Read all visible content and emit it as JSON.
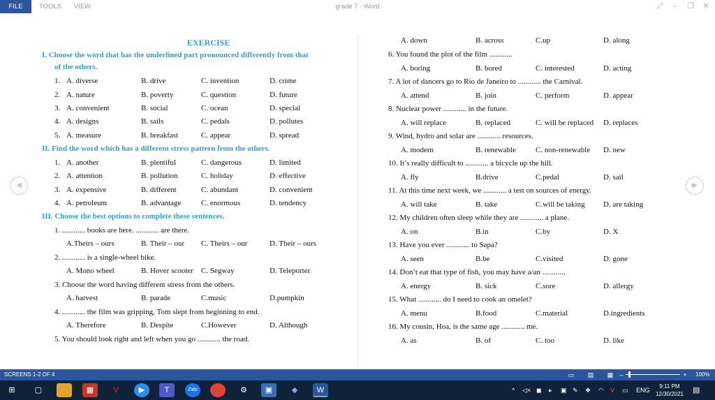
{
  "window": {
    "file_tab": "FILE",
    "tools_tab": "TOOLS",
    "view_tab": "VIEW",
    "title": "grade 7 - Word"
  },
  "left": {
    "title": "EXERCISE",
    "sec1_h1": "I.   Choose the word that has the underlined part pronounced differently from that",
    "sec1_h2": "of the others.",
    "s1": [
      {
        "n": "1.",
        "a": "A. diverse",
        "b": "B. drive",
        "c": "C. invention",
        "d": "D. crime"
      },
      {
        "n": "2.",
        "a": "A. nature",
        "b": "B. poverty",
        "c": "C. question",
        "d": "D. future"
      },
      {
        "n": "3.",
        "a": "A. convenient",
        "b": "B. social",
        "c": "C. ocean",
        "d": "D. special"
      },
      {
        "n": "4.",
        "a": "A. designs",
        "b": "B. sails",
        "c": "C. pedals",
        "d": "D. pollutes"
      },
      {
        "n": "5.",
        "a": "A. measure",
        "b": "B. breakfast",
        "c": "C. appear",
        "d": "D. spread"
      }
    ],
    "sec2_h": "II.  Find the word which has a different stress pattern from the others.",
    "s2": [
      {
        "n": "1.",
        "a": "A. another",
        "b": "B. plentiful",
        "c": "C. dangerous",
        "d": "D. limited"
      },
      {
        "n": "2.",
        "a": "A. attention",
        "b": "B. pollution",
        "c": "C. holiday",
        "d": "D. effective"
      },
      {
        "n": "3.",
        "a": "A. expensive",
        "b": "B. different",
        "c": "C. abundant",
        "d": "D. convenient"
      },
      {
        "n": "4.",
        "a": "A. petroleum",
        "b": "B. advantage",
        "c": "C. enormous",
        "d": "D. tendency"
      }
    ],
    "sec3_h": "III. Choose the best options to complete these sentences.",
    "q1": "1.   ............ books are here. ............ are there.",
    "q1o": {
      "a": "A.Theirs – ours",
      "b": "B. Their – our",
      "c": "C. Theirs – our",
      "d": "D. Their – ours"
    },
    "q2": "2.   ............ is a single-wheel bike.",
    "q2o": {
      "a": "A. Mono wheel",
      "b": "B. Hover scooter",
      "c": "C. Segway",
      "d": "D. Teleporter"
    },
    "q3": "3.  Choose the word having different stress from the others.",
    "q3o": {
      "a": "A. harvest",
      "b": "B. parade",
      "c": "C.music",
      "d": "D.pumpkin"
    },
    "q4": "4.   ............ the film was gripping, Tom slept from beginning to end.",
    "q4o": {
      "a": "A. Therefore",
      "b": "B. Despite",
      "c": "C.However",
      "d": "D. Although"
    },
    "q5": "5.  You should look right and left when you go      ............ the road."
  },
  "right": {
    "q5o": {
      "a": "A. down",
      "b": "B. across",
      "c": "C.up",
      "d": "D. along"
    },
    "qs": [
      {
        "q": "6.  You found the plot of the film ............",
        "a": "A. boring",
        "b": "B. bored",
        "c": "C. interested",
        "d": "D. acting"
      },
      {
        "q": "7.  A lot of dancers go to Rio de Janeiro to ............ the Carnival.",
        "a": "A. attend",
        "b": "B. join",
        "c": "C. perform",
        "d": "D. appear"
      },
      {
        "q": "8.  Nuclear power          ............ in the future.",
        "a": "A. will replace",
        "b": "B. replaced",
        "c": "C. will be replaced",
        "d": "D. replaces"
      },
      {
        "q": "9.  Wind, hydro and solar are ............ resources.",
        "a": "A. modern",
        "b": "B. renewable",
        "c": "C. non-renewable",
        "d": "D. new"
      },
      {
        "q": "10.          It’s really difficult to ............ a bicycle up the hill.",
        "a": "A. fly",
        "b": "B.drive",
        "c": "C.pedal",
        "d": "D. sail"
      },
      {
        "q": "11.          At this time next week, we ............ a test on sources of energy.",
        "a": "A. will take",
        "b": "B. take",
        "c": "C.will be taking",
        "d": "D. are taking"
      },
      {
        "q": "12.          My children often sleep while they are ............ a plane.",
        "a": "A. on",
        "b": "B.in",
        "c": "C.by",
        "d": "D. X"
      },
      {
        "q": "13.          Have you ever          ............ to Sapa?",
        "a": "A. seen",
        "b": "B.be",
        "c": "C.visited",
        "d": "D. gone"
      },
      {
        "q": "14.          Don’t eat that type of fish, you may have a/an ............",
        "a": "A. energy",
        "b": "B. sick",
        "c": "C.sore",
        "d": "D. allergy"
      },
      {
        "q": "15.          What ............ do I need to cook an omelet?",
        "a": "A. menu",
        "b": "B.food",
        "c": "C.material",
        "d": "D.ingredients"
      },
      {
        "q": "16.          My cousin, Hoa, is the same age ............ me.",
        "a": "A. as",
        "b": "B. of",
        "c": "C. too",
        "d": "D. like"
      }
    ]
  },
  "status": {
    "screens": "SCREENS 1-2 OF 4",
    "zoom": "100%"
  },
  "taskbar": {
    "lang": "ENG",
    "time": "9:11 PM",
    "date": "12/30/2021"
  },
  "colors": {
    "accent": "#2b579a",
    "heading": "#2e9fd6",
    "taskbar": "#10213a"
  }
}
